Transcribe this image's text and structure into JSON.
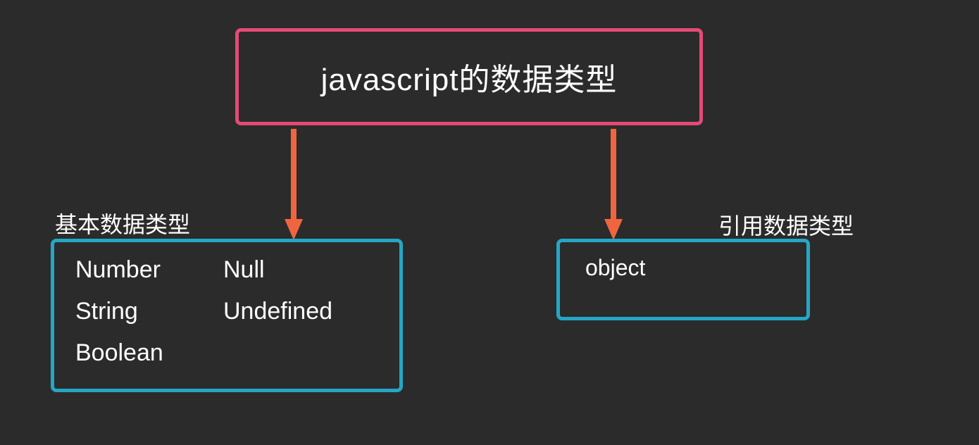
{
  "root": {
    "title": "javascript的数据类型"
  },
  "labels": {
    "basic": "基本数据类型",
    "reference": "引用数据类型"
  },
  "basic": {
    "items": [
      [
        "Number",
        "Null"
      ],
      [
        "String",
        "Undefined"
      ],
      [
        "Boolean",
        ""
      ]
    ]
  },
  "reference": {
    "item": "object"
  },
  "colors": {
    "background": "#2b2b2b",
    "rootBorder": "#e54a77",
    "childBorder": "#24a7c4",
    "arrow": "#ef6540",
    "text": "#ffffff"
  }
}
